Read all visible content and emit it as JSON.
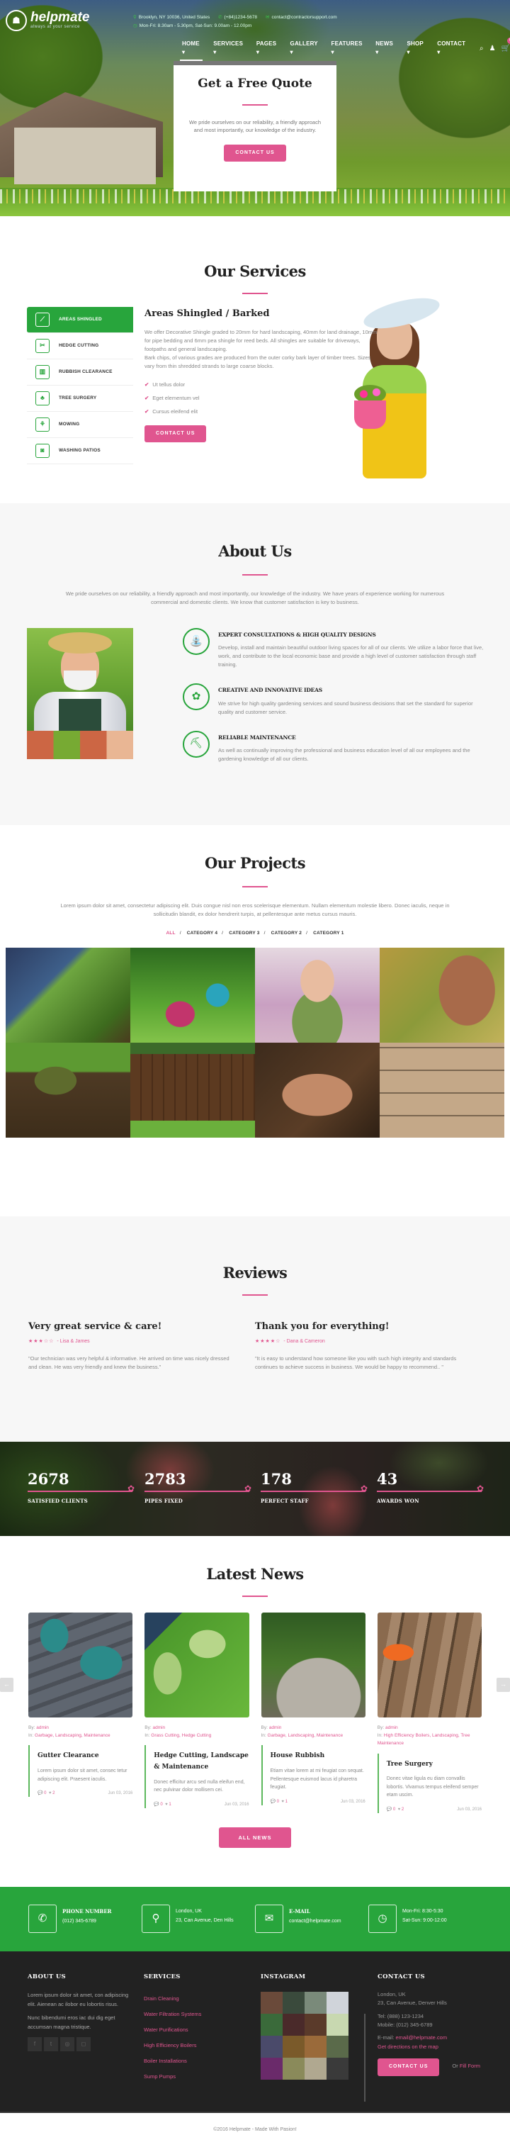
{
  "header": {
    "logo_name": "helpmate",
    "logo_tagline": "always at your service",
    "address": "Brooklyn, NY 10036, United States",
    "phone": "(+84)1234-5678",
    "email": "contact@contractorsupport.com",
    "hours": "Mon-Fri: 8.30am - 5.30pm, Sat-Sun: 9.00am - 12.00pm",
    "nav": [
      "HOME",
      "SERVICES",
      "PAGES",
      "GALLERY",
      "FEATURES",
      "NEWS",
      "SHOP",
      "CONTACT"
    ],
    "active_nav": "HOME",
    "cart_count": "0"
  },
  "hero": {
    "title": "Get a Free Quote",
    "text": "We pride ourselves on our reliability, a friendly approach and most importantly, our knowledge of the industry.",
    "button": "CONTACT US"
  },
  "services": {
    "title": "Our Services",
    "tabs": [
      {
        "label": "AREAS SHINGLED",
        "icon": "shovel-icon",
        "active": true
      },
      {
        "label": "HEDGE CUTTING",
        "icon": "scissors-icon",
        "active": false
      },
      {
        "label": "RUBBISH CLEARANCE",
        "icon": "trash-icon",
        "active": false
      },
      {
        "label": "TREE SURGERY",
        "icon": "tree-icon",
        "active": false
      },
      {
        "label": "MOWING",
        "icon": "mower-icon",
        "active": false
      },
      {
        "label": "WASHING PATIOS",
        "icon": "bucket-icon",
        "active": false
      }
    ],
    "detail_title": "Areas Shingled / Barked",
    "detail_text": "We offer Decorative Shingle graded to 20mm for hard landscaping, 40mm for land drainage, 10mm for pipe bedding and 6mm pea shingle for reed beds. All shingles are suitable for driveways, footpaths and general landscaping.",
    "detail_text2": "Bark chips, of various grades are produced from the outer corky bark layer of timber trees. Sizes vary from thin shredded strands to large coarse blocks.",
    "list": [
      "Ut tellus dolor",
      "Eget elementum vel",
      "Cursus eleifend elit"
    ],
    "button": "CONTACT US"
  },
  "about": {
    "title": "About Us",
    "intro": "We pride ourselves on our reliability, a friendly approach and most importantly, our knowledge of the industry. We have years of experience working for numerous commercial and domestic clients. We know that customer satisfaction is key to business.",
    "features": [
      {
        "title": "EXPERT CONSULTATIONS & HIGH QUALITY DESIGNS",
        "text": "Develop, install and maintain beautiful outdoor living spaces for all of our clients. We utilize a labor force that live, work, and contribute to the local economic base and provide a high level of customer satisfaction through staff training.",
        "icon": "watering-can-icon"
      },
      {
        "title": "CREATIVE AND INNOVATIVE IDEAS",
        "text": "We strive for high quality gardening services and sound business decisions that set the standard for superior quality and customer service.",
        "icon": "flower-icon"
      },
      {
        "title": "RELIABLE MAINTENANCE",
        "text": "As well as continually improving the professional and business education level of all our employees and the gardening knowledge of all our clients.",
        "icon": "shovel-soil-icon"
      }
    ]
  },
  "projects": {
    "title": "Our Projects",
    "intro": "Lorem ipsum dolor sit amet, consectetur adipiscing elit. Duis congue nisl non eros scelerisque elementum. Nullam elementum molestie libero. Donec iaculis, neque in sollicitudin blandit, ex dolor hendrerit turpis, at pellentesque ante metus cursus mauris.",
    "filters": [
      "ALL",
      "CATEGORY 4",
      "CATEGORY 3",
      "CATEGORY 2",
      "CATEGORY 1"
    ],
    "active_filter": "ALL",
    "gallery": [
      "garden-lights",
      "garden-sprayer",
      "florist",
      "pruning-shears",
      "lawn-turf",
      "wooden-fence",
      "planting-seedlings",
      "patio-weeds"
    ]
  },
  "reviews": {
    "title": "Reviews",
    "items": [
      {
        "title": "Very great service & care!",
        "rating": 3,
        "max": 5,
        "author": "- Lisa & James",
        "text": "\"Our technician was very helpful & informative. He arrived on time was nicely dressed and clean. He was very friendly and knew the business.\""
      },
      {
        "title": "Thank you for everything!",
        "rating": 4,
        "max": 5,
        "author": "- Dana & Cameron",
        "text": "\"It is easy to understand how someone like you with such high integrity and standards continues to achieve success in business. We would be happy to recommend.. \""
      }
    ]
  },
  "counters": [
    {
      "value": "2678",
      "label": "SATISFIED CLIENTS"
    },
    {
      "value": "2783",
      "label": "PIPES FIXED"
    },
    {
      "value": "178",
      "label": "PERFECT STAFF"
    },
    {
      "value": "43",
      "label": "AWARDS WON"
    }
  ],
  "news": {
    "title": "Latest News",
    "items": [
      {
        "by_label": "By:",
        "author": "admin",
        "in_label": "In:",
        "categories": "Garbage, Landscaping, Maintenance",
        "title": "Gutter Clearance",
        "text": "Lorem ipsum dolor sit amet, consec tetur adipiscing elit. Praesent iaculis.",
        "comments": "0",
        "likes": "2",
        "date": "Jun 03, 2016"
      },
      {
        "by_label": "By:",
        "author": "admin",
        "in_label": "In:",
        "categories": "Grass Cutting, Hedge Cutting",
        "title": "Hedge Cutting, Landscape & Maintenance",
        "text": "Donec efficitur arcu sed nulla eleifun end, nec pulvinar dolor mollisem cei.",
        "comments": "0",
        "likes": "1",
        "date": "Jun 03, 2016"
      },
      {
        "by_label": "By:",
        "author": "admin",
        "in_label": "In:",
        "categories": "Garbage, Landscaping, Maintenance",
        "title": "House Rubbish",
        "text": "Etiam vitae lorem at mi feugiat con sequat. Pellentesque euismod lacus id pharetra feugiat.",
        "comments": "0",
        "likes": "1",
        "date": "Jun 03, 2016"
      },
      {
        "by_label": "By:",
        "author": "admin",
        "in_label": "In:",
        "categories": "High Efficiency Boilers, Landscaping, Tree Maintenance",
        "title": "Tree Surgery",
        "text": "Donec vitae ligula eu diam convallis lobortis. Vivamus tempus eleifend semper etam uscim.",
        "comments": "0",
        "likes": "2",
        "date": "Jun 03, 2016"
      }
    ],
    "button": "ALL NEWS"
  },
  "strip": [
    {
      "icon": "phone-icon",
      "title": "PHONE NUMBER",
      "line": "(012) 345-6789"
    },
    {
      "icon": "map-pin-icon",
      "title": "London, UK",
      "line": "23, Can Avenue, Den Hills"
    },
    {
      "icon": "envelope-icon",
      "title": "E-MAIL",
      "line": "contact@helpmate.com"
    },
    {
      "icon": "clock-icon",
      "title": "Mon-Fri: 8:30-5:30",
      "line": "Sat-Sun: 9:00-12:00"
    }
  ],
  "footer": {
    "about_title": "ABOUT US",
    "about_p1": "Lorem ipsum dolor sit amet, con adipiscing elit. Aienean ac ilobor eu lobortis risus.",
    "about_p2": "Nunc bibendumi eros iac dui dig eget accumsan magna tristique.",
    "social": [
      "facebook-icon",
      "twitter-icon",
      "tripadvisor-icon",
      "instagram-icon"
    ],
    "services_title": "SERVICES",
    "services": [
      "Drain Cleaning",
      "Water Filtration Systems",
      "Water Purifications",
      "High Efficiency Boilers",
      "Boiler Installations",
      "Sump Pumps"
    ],
    "instagram_title": "INSTAGRAM",
    "contact_title": "CONTACT US",
    "contact_city": "London, UK",
    "contact_address": "23, Can Avenue, Denver Hills",
    "contact_tel": "Tel: (888) 123-1234",
    "contact_mobile": "Mobile: (012) 345-6789",
    "contact_email_label": "E-mail:",
    "contact_email": "email@helpmate.com",
    "directions": "Get directions on the map",
    "button": "CONTACT US",
    "or_label": "Or",
    "fill_form": "Fill Form",
    "copyright": "©2016 Helpmate - Made With Pasion!"
  },
  "colors": {
    "accent_pink": "#e0558f",
    "brand_green": "#28a53c",
    "footer_dark": "#222222"
  }
}
